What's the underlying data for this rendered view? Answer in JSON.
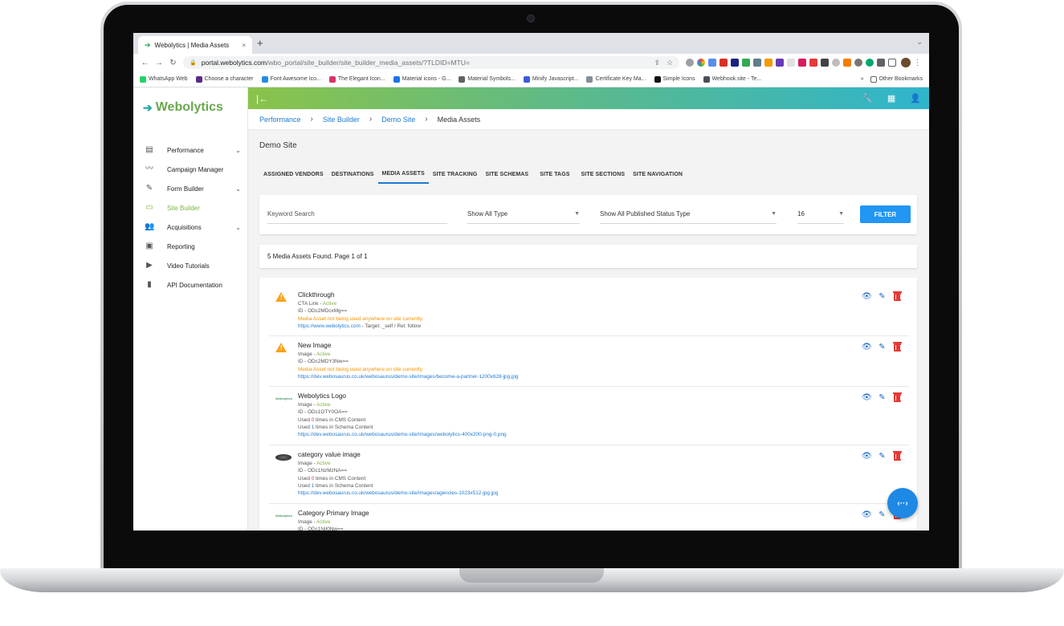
{
  "browser": {
    "tab_title": "Webolytics | Media Assets",
    "tab_close": "×",
    "new_tab": "+",
    "url_host": "portal.webolytics.com",
    "url_path": "/wbo_portal/site_builder/site_builder_media_assets/?TLDID=MTU=",
    "bookmarks": [
      {
        "label": "WhatsApp Web",
        "color": "#25d366"
      },
      {
        "label": "Choose a character",
        "color": "#5b2a86"
      },
      {
        "label": "Font Awesome Ico...",
        "color": "#228be6"
      },
      {
        "label": "The Elegant Icon...",
        "color": "#d6336c"
      },
      {
        "label": "Material icons - G...",
        "color": "#1a73e8"
      },
      {
        "label": "Material Symbols...",
        "color": "#5f6368"
      },
      {
        "label": "Minify Javascript...",
        "color": "#3b5bdb"
      },
      {
        "label": "Certificate Key Ma...",
        "color": "#868e96"
      },
      {
        "label": "Simple Icons",
        "color": "#111111"
      },
      {
        "label": "Webhook.site - Te...",
        "color": "#495057"
      }
    ],
    "bookmarks_more": "»",
    "other_bookmarks": "Other Bookmarks"
  },
  "brand": {
    "name": "Webolytics",
    "green": "#6aa84f",
    "blue": "#1e7bd1"
  },
  "sidebar": {
    "items": [
      {
        "label": "Performance",
        "has_chevron": true
      },
      {
        "label": "Campaign Manager",
        "has_chevron": false
      },
      {
        "label": "Form Builder",
        "has_chevron": true
      },
      {
        "label": "Site Builder",
        "has_chevron": false,
        "active": true
      },
      {
        "label": "Acquisitions",
        "has_chevron": true
      },
      {
        "label": "Reporting",
        "has_chevron": false
      },
      {
        "label": "Video Tutorials",
        "has_chevron": false
      },
      {
        "label": "API Documentation",
        "has_chevron": false
      }
    ]
  },
  "breadcrumb": {
    "items": [
      "Performance",
      "Site Builder",
      "Demo Site"
    ],
    "current": "Media Assets"
  },
  "page": {
    "title": "Demo Site"
  },
  "tabs": [
    "ASSIGNED VENDORS",
    "DESTINATIONS",
    "MEDIA ASSETS",
    "SITE TRACKING",
    "SITE SCHEMAS",
    "SITE TAGS",
    "SITE SECTIONS",
    "SITE NAVIGATION"
  ],
  "active_tab": "MEDIA ASSETS",
  "filters": {
    "keyword_placeholder": "Keyword Search",
    "type_value": "Show All Type",
    "status_value": "Show All Published Status Type",
    "count_value": "16",
    "button_label": "FILTER"
  },
  "summary": "5 Media Assets Found. Page 1 of 1",
  "assets": [
    {
      "title": "Clickthrough",
      "kind": "CTA Link - ",
      "status": "Active",
      "id": "ID - ODc2MDcxMg==",
      "warning": "Media Asset not being used anywhere on site currently.",
      "url": "https://www.webolytics.com",
      "url_suffix": " - Target: _self / Rel: follow",
      "thumb": "warning-icon"
    },
    {
      "title": "New Image",
      "kind": "Image - ",
      "status": "Active",
      "id": "ID - ODc2MDY3Nw==",
      "warning": "Media Asset not being used anywhere on site currently.",
      "url": "https://dev.webosaurus.co.uk/webosaurus/demo-site/images/become-a-partner-1200x628-jpg.jpg",
      "thumb": "warning-icon"
    },
    {
      "title": "Webolytics Logo",
      "kind": "Image - ",
      "status": "Active",
      "id": "ID - ODc1OTY0OA==",
      "cms_prefix": "Used ",
      "cms_count": "0",
      "cms_suffix": " times in CMS Content",
      "schema_prefix": "Used ",
      "schema_count": "1",
      "schema_suffix": " times in Schema Content",
      "url": "https://dev.webosaurus.co.uk/webosaurus/demo-site/images/webolytics-400x200-png-0.png",
      "thumb": "logo"
    },
    {
      "title": "category value image",
      "kind": "Image - ",
      "status": "Active",
      "id": "ID - ODc1NzMzNA==",
      "cms_prefix": "Used ",
      "cms_count": "0",
      "cms_suffix": " times in CMS Content",
      "schema_prefix": "Used ",
      "schema_count": "1",
      "schema_suffix": " times in Schema Content",
      "url": "https://dev.webosaurus.co.uk/webosaurus/demo-site/images/agencies-1023x512-jpg.jpg",
      "thumb": "photo"
    },
    {
      "title": "Category Primary Image",
      "kind": "Image - ",
      "status": "Active",
      "id": "ID - ODc1NjI0Nw==",
      "thumb": "logo"
    }
  ],
  "thumb_logo_text": "Webolytics",
  "colors": {
    "warning": "#f7a21b",
    "active": "#7cb342",
    "danger": "#e53935",
    "action_blue": "#1565c0",
    "filter_button": "#2196f3"
  }
}
